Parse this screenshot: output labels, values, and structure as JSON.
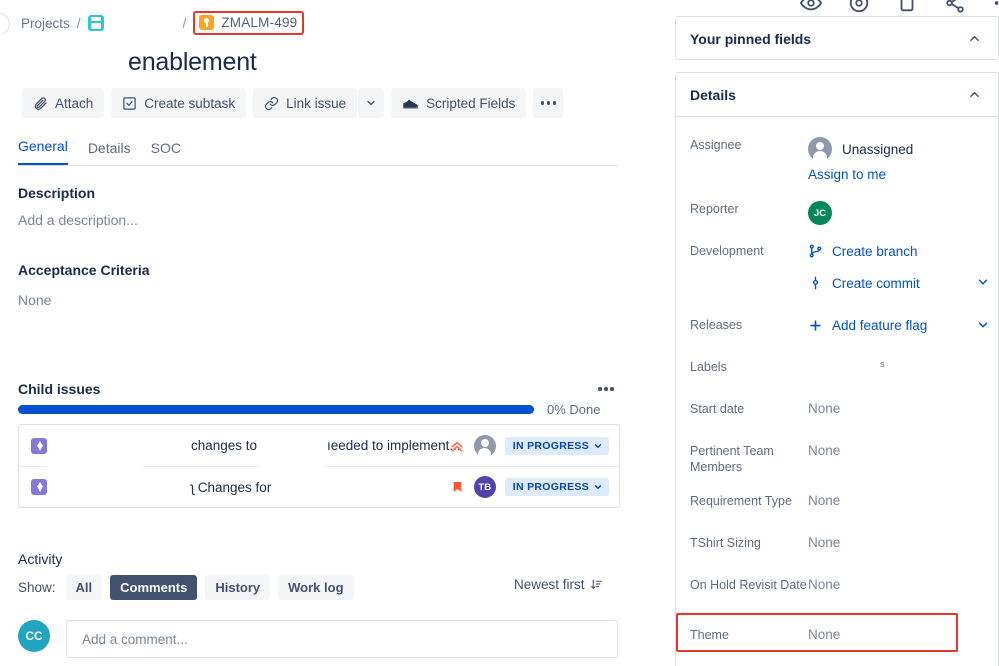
{
  "breadcrumb": {
    "projects_label": "Projects",
    "separator": "/",
    "project_icon": "project-board-icon",
    "issue_key": "ZMALM-499",
    "issue_type_icon": "story-icon",
    "highlight_color": "#e8362b"
  },
  "issue": {
    "title": "enablement"
  },
  "toolbar": {
    "attach_label": "Attach",
    "create_subtask_label": "Create subtask",
    "link_issue_label": "Link issue",
    "scripted_fields_label": "Scripted Fields",
    "more_label": "•••",
    "caret_icon": "chevron-down-icon"
  },
  "tabs": [
    {
      "label": "General",
      "active": true
    },
    {
      "label": "Details",
      "active": false
    },
    {
      "label": "SOC",
      "active": false
    }
  ],
  "description": {
    "heading": "Description",
    "placeholder": "Add a description..."
  },
  "acceptance_criteria": {
    "heading": "Acceptance Criteria",
    "value": "None"
  },
  "child_issues": {
    "heading": "Child issues",
    "progress_percent": 0,
    "progress_fill_percent": 100,
    "progress_label": "0% Done",
    "progress_color": "#0052cc",
    "rows": [
      {
        "type_icon": "subtask-icon",
        "text_a": "changes to",
        "text_b": "ıeeded to implement...",
        "priority_icon": "priority-highest-icon",
        "priority_color": "#ff7452",
        "avatar_initials": "",
        "avatar_type": "unassigned",
        "status": "IN PROGRESS"
      },
      {
        "type_icon": "subtask-icon",
        "text_a": "ʅ Changes for",
        "text_b": "",
        "priority_icon": "priority-major-icon",
        "priority_color": "#ff5630",
        "avatar_initials": "TB",
        "avatar_type": "initials",
        "avatar_color": "#5243aa",
        "status": "IN PROGRESS"
      }
    ]
  },
  "activity": {
    "heading": "Activity",
    "show_label": "Show:",
    "filters": [
      {
        "label": "All",
        "active": false
      },
      {
        "label": "Comments",
        "active": true
      },
      {
        "label": "History",
        "active": false
      },
      {
        "label": "Work log",
        "active": false
      }
    ],
    "sort_label": "Newest first",
    "sort_icon": "sort-descending-icon",
    "comment_avatar_initials": "CC",
    "comment_avatar_color": "#1fa5c0",
    "comment_placeholder": "Add a comment..."
  },
  "right_panel": {
    "top_icons": [
      "watch-icon",
      "like-icon",
      "copy-link-icon",
      "share-icon",
      "more-icon"
    ],
    "pinned_fields": {
      "title": "Your pinned fields",
      "collapse_icon": "chevron-up-icon"
    },
    "details": {
      "title": "Details",
      "collapse_icon": "chevron-up-icon"
    },
    "fields": {
      "assignee": {
        "label": "Assignee",
        "value": "Unassigned",
        "action": "Assign to me",
        "avatar": "unassigned-avatar-icon"
      },
      "reporter": {
        "label": "Reporter",
        "avatar_initials": "JC",
        "avatar_color": "#00875a"
      },
      "development": {
        "label": "Development",
        "create_branch": "Create branch",
        "create_branch_icon": "branch-icon",
        "create_commit": "Create commit",
        "create_commit_icon": "commit-icon",
        "caret_icon": "chevron-down-icon"
      },
      "releases": {
        "label": "Releases",
        "action": "Add feature flag",
        "plus_icon": "plus-icon",
        "caret_icon": "chevron-down-icon"
      },
      "labels": {
        "label": "Labels",
        "value": "s"
      },
      "start_date": {
        "label": "Start date",
        "value": "None"
      },
      "pertinent_team_members": {
        "label": "Pertinent Team Members",
        "value": "None"
      },
      "requirement_type": {
        "label": "Requirement Type",
        "value": "None"
      },
      "tshirt_sizing": {
        "label": "TShirt Sizing",
        "value": "None"
      },
      "on_hold_revisit_date": {
        "label": "On Hold Revisit Date",
        "value": "None"
      },
      "theme": {
        "label": "Theme",
        "value": "None",
        "highlighted": true,
        "highlight_color": "#e8362b"
      }
    }
  }
}
